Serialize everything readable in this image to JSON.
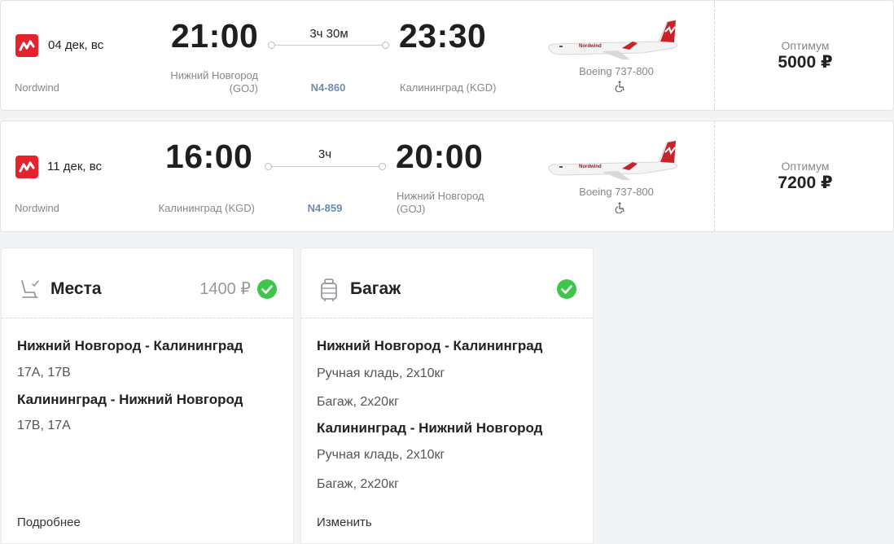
{
  "flights": [
    {
      "date": "04 дек, вс",
      "airline": "Nordwind",
      "depart_time": "21:00",
      "depart_place_line1": "Нижний Новгород",
      "depart_place_line2": "(GOJ)",
      "duration": "3ч 30м",
      "flight_number": "N4-860",
      "arrive_time": "23:30",
      "arrive_place_line1": "Калининград (KGD)",
      "arrive_place_line2": "",
      "aircraft": "Boeing 737-800",
      "fare_label": "Оптимум",
      "fare_price": "5000 ₽"
    },
    {
      "date": "11 дек, вс",
      "airline": "Nordwind",
      "depart_time": "16:00",
      "depart_place_line1": "Калининград (KGD)",
      "depart_place_line2": "",
      "duration": "3ч",
      "flight_number": "N4-859",
      "arrive_time": "20:00",
      "arrive_place_line1": "Нижний Новгород",
      "arrive_place_line2": "(GOJ)",
      "aircraft": "Boeing 737-800",
      "fare_label": "Оптимум",
      "fare_price": "7200 ₽"
    }
  ],
  "plane_livery_text": "Nordwind",
  "seats": {
    "title": "Места",
    "price": "1400 ₽",
    "routes": [
      {
        "title": "Нижний Новгород - Калининград",
        "seats": "17A, 17B"
      },
      {
        "title": "Калининград - Нижний Новгород",
        "seats": "17B, 17A"
      }
    ],
    "link": "Подробнее"
  },
  "baggage": {
    "title": "Багаж",
    "routes": [
      {
        "title": "Нижний Новгород - Калининград",
        "hand": "Ручная кладь,  2x10кг",
        "bag": "Багаж,  2x20кг"
      },
      {
        "title": "Калининград - Нижний Новгород",
        "hand": "Ручная кладь,  2x10кг",
        "bag": "Багаж,  2x20кг"
      }
    ],
    "link": "Изменить"
  },
  "colors": {
    "brand_red": "#e4232f",
    "check_green": "#3ec54a",
    "flight_number_blue": "#6a8cad"
  },
  "icons": [
    "nordwind-logo-icon",
    "airplane-image-icon",
    "wheelchair-icon",
    "seat-icon",
    "suitcase-icon",
    "check-icon"
  ]
}
